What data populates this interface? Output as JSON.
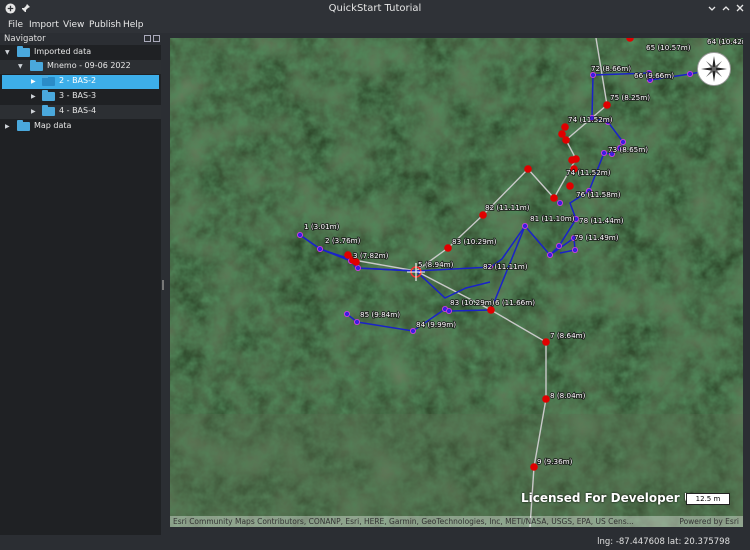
{
  "window": {
    "title": "QuickStart Tutorial"
  },
  "menubar": [
    {
      "label": "File",
      "mnemonic": "F"
    },
    {
      "label": "Import",
      "mnemonic": "I"
    },
    {
      "label": "View",
      "mnemonic": "V"
    },
    {
      "label": "Publish",
      "mnemonic": "P"
    },
    {
      "label": "Help",
      "mnemonic": "H"
    }
  ],
  "navigator": {
    "title": "Navigator",
    "tree": [
      {
        "label": "Imported data",
        "level": 0,
        "expanded": true
      },
      {
        "label": "Mnemo - 09-06 2022",
        "level": 1,
        "expanded": true
      },
      {
        "label": "2 - BAS-2",
        "level": 2,
        "selected": true
      },
      {
        "label": "3 - BAS-3",
        "level": 2
      },
      {
        "label": "4 - BAS-4",
        "level": 2
      },
      {
        "label": "Map data",
        "level": 0,
        "expanded": false
      }
    ]
  },
  "map": {
    "watermark": "Licensed For Developer U",
    "scale": "12.5 m",
    "attribution": "Esri Community Maps Contributors, CONANP, Esri, HERE, Garmin, GeoTechnologies, Inc, METI/NASA, USGS, EPA, US Cens...",
    "powered_by": "Powered by Esri",
    "colors": {
      "survey_line": "#1a22c8",
      "main_line": "#c9c9c9",
      "station": "#e00000",
      "shot": "#3b1fe0"
    },
    "labels": {
      "l1": "1 (3.01m)",
      "l2": "2 (3.76m)",
      "l3": "3 (7.82m)",
      "l5": "5 (8.94m)",
      "l6": "6 (11.66m)",
      "l7": "7 (8.64m)",
      "l8": "8 (8.04m)",
      "l9": "9 (9.36m)",
      "l82a": "82 (11.11m)",
      "l82b": "82 (11.11m)",
      "l83a": "83 (10.29m)",
      "l83b": "83 (10.29m)",
      "l81": "81 (11.10m)",
      "l84": "84 (9.99m)",
      "l85": "85 (9.84m)",
      "l79": "79 (11.49m)",
      "l78": "78 (11.44m)",
      "l76": "76 (11.58m)",
      "l74a": "74 (11.52m)",
      "l73": "73 (8.65m)",
      "l74b": "74 (11.52m)",
      "l75": "75 (8.25m)",
      "l72": "72 (8.66m)",
      "l66": "66 (9.66m)",
      "l65": "65 (10.57m)",
      "l64": "64 (10.42m)"
    }
  },
  "statusbar": {
    "coords": "lng: -87.447608 lat: 20.375798"
  }
}
